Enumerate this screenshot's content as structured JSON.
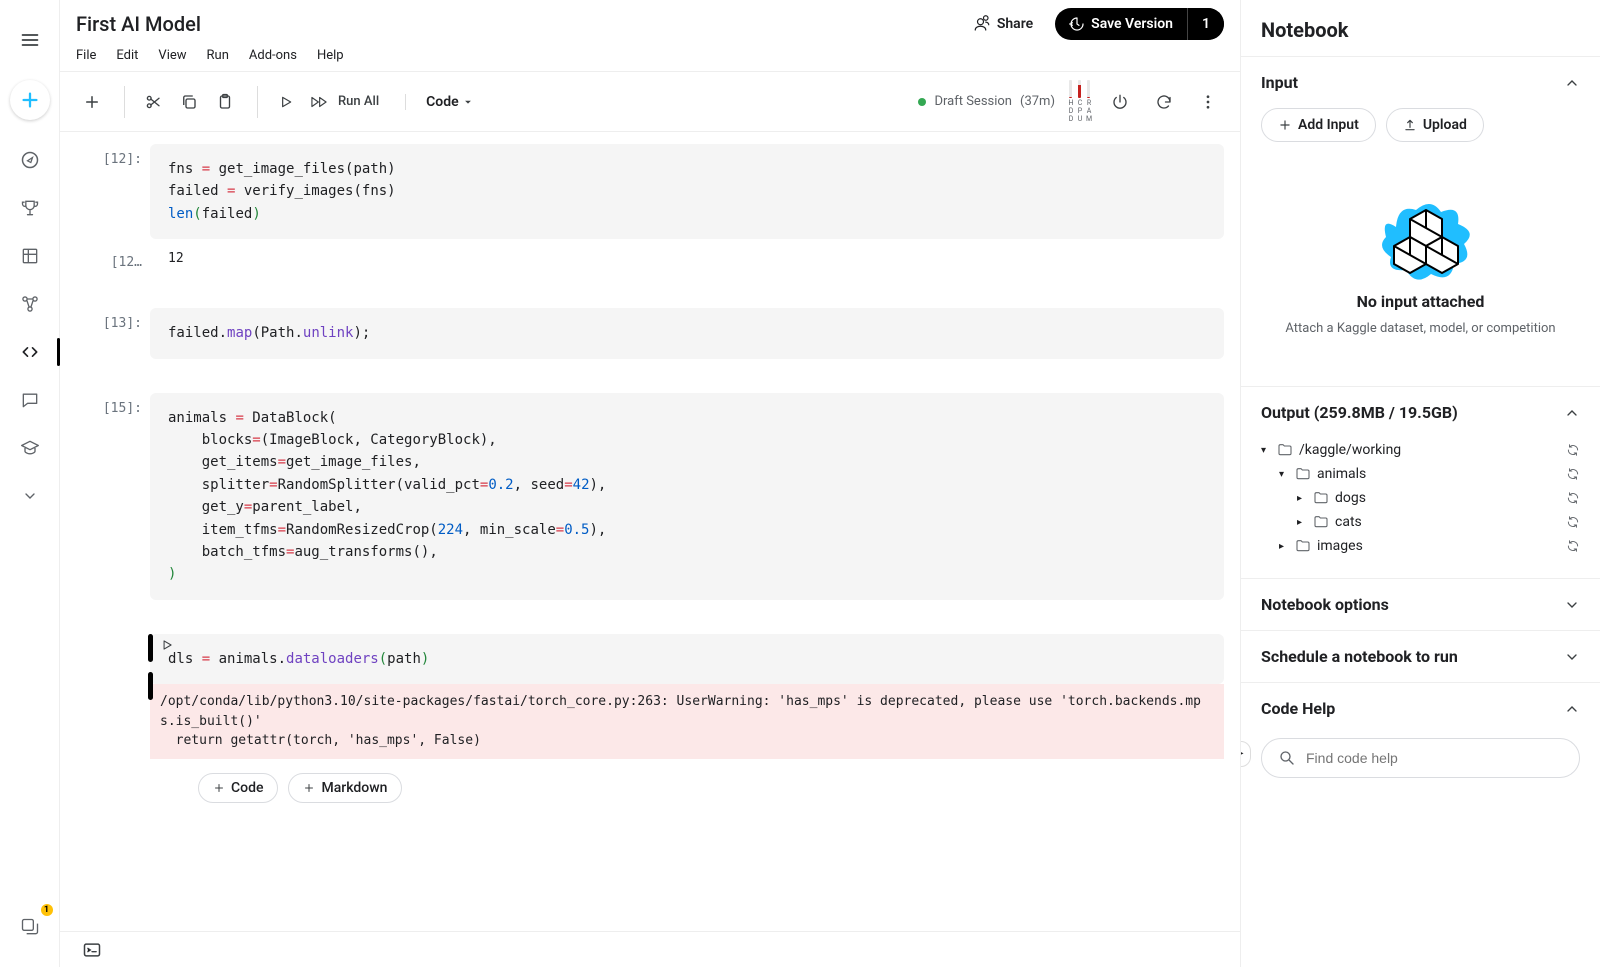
{
  "notebook_title": "First AI Model",
  "menu": {
    "file": "File",
    "edit": "Edit",
    "view": "View",
    "run": "Run",
    "addons": "Add-ons",
    "help": "Help"
  },
  "header_actions": {
    "share": "Share",
    "save": "Save Version",
    "save_count": "1"
  },
  "toolbar": {
    "run_all": "Run All",
    "code_dropdown": "Code",
    "session_label": "Draft Session",
    "session_time": "(37m)"
  },
  "meters": [
    {
      "label": "HDD",
      "fill": 5
    },
    {
      "label": "CPU",
      "fill": 70
    },
    {
      "label": "RAM",
      "fill": 8
    }
  ],
  "cells": [
    {
      "prompt": "[12]:",
      "code_html": "fns <span class='s-op'>=</span> get_image_files(path)\nfailed <span class='s-op'>=</span> verify_images(fns)\n<span class='s-builtin'>len</span><span class='s-paren'>(</span>failed<span class='s-paren'>)</span>"
    },
    {
      "prompt": "[12…",
      "output": "12"
    },
    {
      "prompt": "[13]:",
      "code_html": "failed.<span class='s-call'>map</span>(Path.<span class='s-call'>unlink</span>);"
    },
    {
      "prompt": "[15]:",
      "code_html": "animals <span class='s-op'>=</span> DataBlock(\n    blocks<span class='s-op'>=</span>(ImageBlock, CategoryBlock),\n    get_items<span class='s-op'>=</span>get_image_files,\n    splitter<span class='s-op'>=</span>RandomSplitter(valid_pct<span class='s-op'>=</span><span class='s-num'>0.2</span>, seed<span class='s-op'>=</span><span class='s-num'>42</span>),\n    get_y<span class='s-op'>=</span>parent_label,\n    item_tfms<span class='s-op'>=</span>RandomResizedCrop(<span class='s-num'>224</span>, min_scale<span class='s-op'>=</span><span class='s-num'>0.5</span>),\n    batch_tfms<span class='s-op'>=</span>aug_transforms(),\n<span class='s-paren'>)</span>"
    },
    {
      "prompt": "",
      "active": true,
      "code_html": "dls <span class='s-op'>=</span> animals.<span class='s-call'>dataloaders</span><span class='s-paren'>(</span>path<span class='s-paren'>)</span>",
      "error": "/opt/conda/lib/python3.10/site-packages/fastai/torch_core.py:263: UserWarning: 'has_mps' is deprecated, please use 'torch.backends.mps.is_built()'\n  return getattr(torch, 'has_mps', False)"
    }
  ],
  "add_buttons": {
    "code": "Code",
    "markdown": "Markdown"
  },
  "right_panel": {
    "title": "Notebook",
    "input": {
      "header": "Input",
      "add": "Add Input",
      "upload": "Upload",
      "empty_title": "No input attached",
      "empty_sub": "Attach a Kaggle dataset, model, or competition"
    },
    "output": {
      "header": "Output (259.8MB / 19.5GB)",
      "tree": [
        {
          "name": "/kaggle/working",
          "indent": 0,
          "open": true
        },
        {
          "name": "animals",
          "indent": 1,
          "open": true
        },
        {
          "name": "dogs",
          "indent": 2,
          "open": false
        },
        {
          "name": "cats",
          "indent": 2,
          "open": false
        },
        {
          "name": "images",
          "indent": 1,
          "open": false
        }
      ]
    },
    "options_header": "Notebook options",
    "schedule_header": "Schedule a notebook to run",
    "codehelp_header": "Code Help",
    "codehelp_placeholder": "Find code help"
  },
  "left_rail_badge": "1"
}
